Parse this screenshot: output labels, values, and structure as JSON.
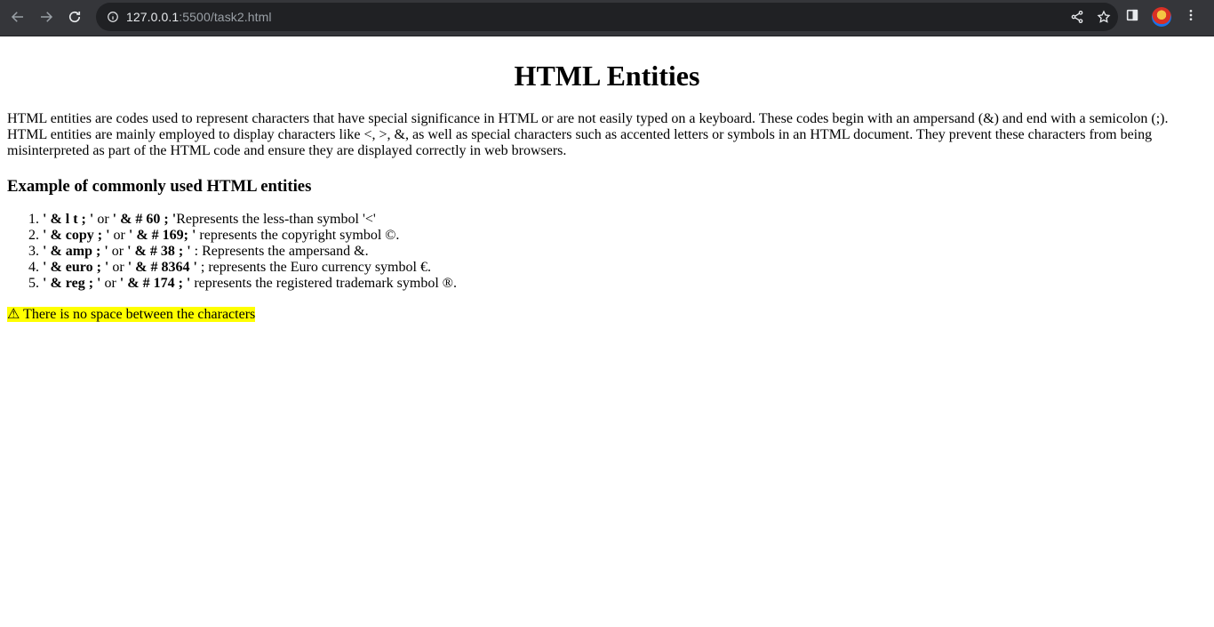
{
  "browser": {
    "url_host": "127.0.0.1",
    "url_path": ":5500/task2.html"
  },
  "page": {
    "title": "HTML Entities",
    "intro": "HTML entities are codes used to represent characters that have special significance in HTML or are not easily typed on a keyboard. These codes begin with an ampersand (&) and end with a semicolon (;). HTML entities are mainly employed to display characters like <, >, &, as well as special characters such as accented letters or symbols in an HTML document. They prevent these characters from being misinterpreted as part of the HTML code and ensure they are displayed correctly in web browsers.",
    "subtitle": "Example of commonly used HTML entities",
    "items": [
      {
        "name_code": "' & l t ; '",
        "or": " or ",
        "num_code": "' & # 60 ; '",
        "desc": "Represents the less-than symbol '<'"
      },
      {
        "name_code": "' & copy ; '",
        "or": " or ",
        "num_code": "' & # 169; '",
        "desc": " represents the copyright symbol ©."
      },
      {
        "name_code": "' & amp ; '",
        "or": " or ",
        "num_code": "' & # 38 ; '",
        "desc": " : Represents the ampersand &."
      },
      {
        "name_code": "' & euro ; '",
        "or": " or ",
        "num_code": "' & # 8364 '",
        "desc": " ; represents the Euro currency symbol €."
      },
      {
        "name_code": "' & reg ; '",
        "or": " or ",
        "num_code": "' & # 174 ; '",
        "desc": " represents the registered trademark symbol ®."
      }
    ],
    "note": "⚠ There is no space between the characters"
  }
}
